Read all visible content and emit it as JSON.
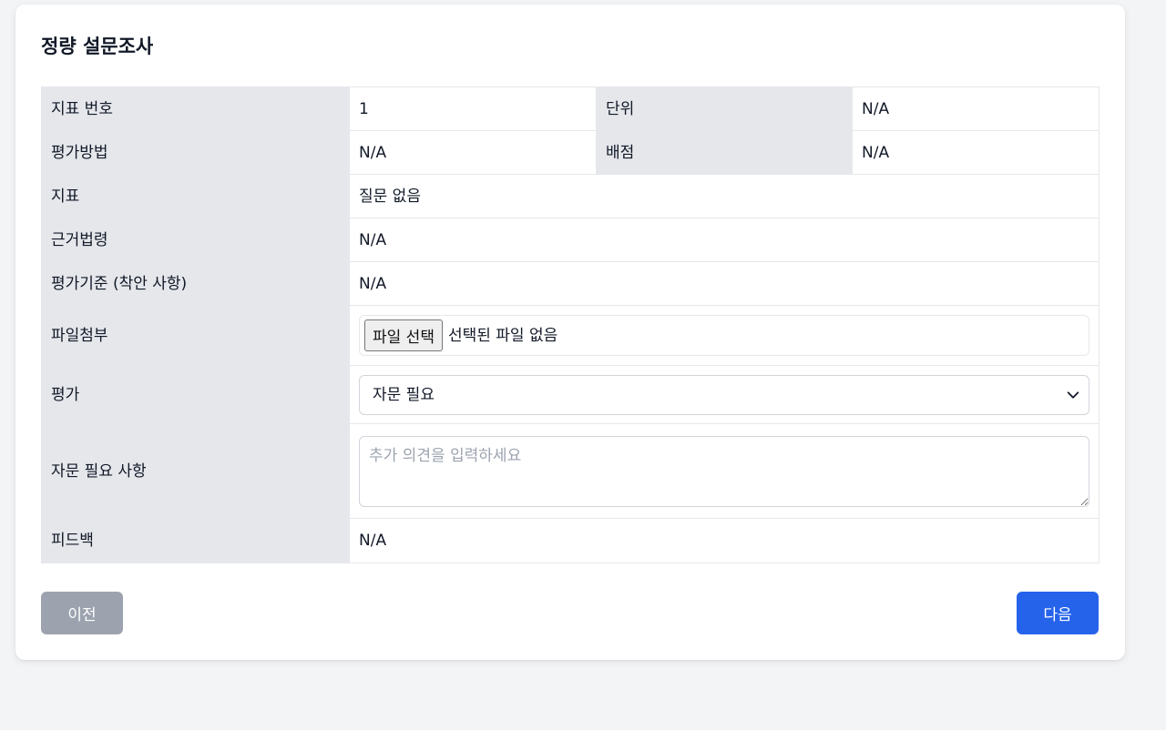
{
  "page": {
    "title": "정량 설문조사"
  },
  "table": {
    "indicator_number_label": "지표 번호",
    "indicator_number_value": "1",
    "unit_label": "단위",
    "unit_value": "N/A",
    "eval_method_label": "평가방법",
    "eval_method_value": "N/A",
    "points_label": "배점",
    "points_value": "N/A",
    "indicator_label": "지표",
    "indicator_value": "질문 없음",
    "legal_basis_label": "근거법령",
    "legal_basis_value": "N/A",
    "criteria_label": "평가기준 (착안 사항)",
    "criteria_value": "N/A",
    "file_label": "파일첨부",
    "file_button": "파일 선택",
    "file_status": "선택된 파일 없음",
    "evaluation_label": "평가",
    "evaluation_selected": "자문 필요",
    "consult_label": "자문 필요 사항",
    "consult_placeholder": "추가 의견을 입력하세요",
    "feedback_label": "피드백",
    "feedback_value": "N/A"
  },
  "buttons": {
    "prev": "이전",
    "next": "다음"
  },
  "colors": {
    "label_bg": "#e5e7eb",
    "prev_button": "#9ca3af",
    "next_button": "#2563eb"
  }
}
